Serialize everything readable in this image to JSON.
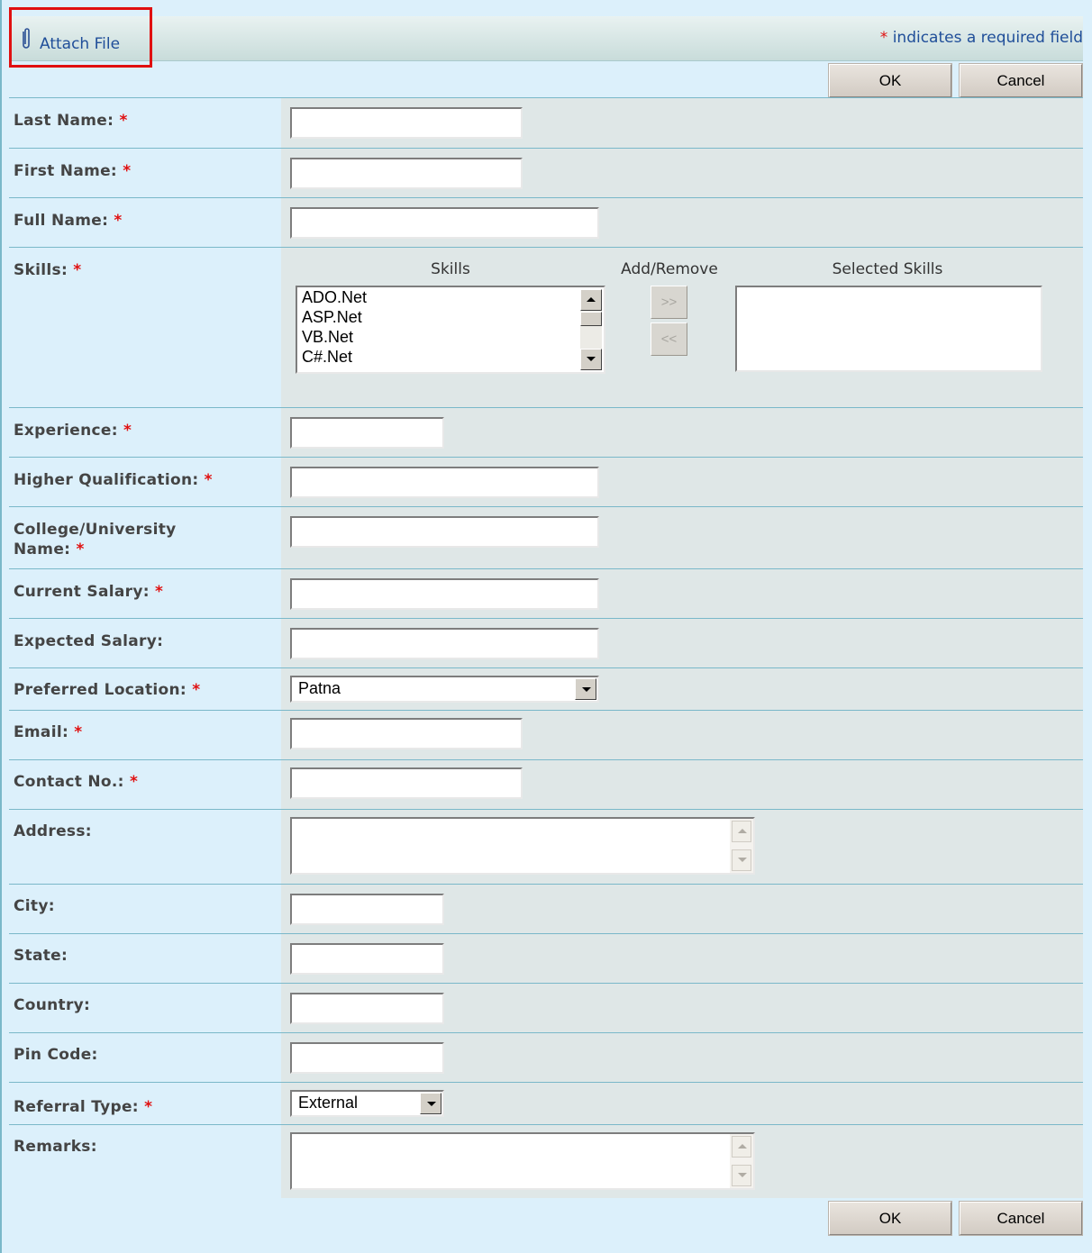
{
  "toolbar": {
    "attach_label": "Attach File",
    "required_note_star": "*",
    "required_note_text": " indicates a required field"
  },
  "buttons": {
    "ok": "OK",
    "cancel": "Cancel"
  },
  "colors": {
    "required": "#e01010",
    "link": "#1f4e99",
    "page_bg": "#dcf0fb",
    "field_bg": "#dfe7e7"
  },
  "fields": {
    "last_name": {
      "label": "Last Name:",
      "value": ""
    },
    "first_name": {
      "label": "First Name:",
      "value": ""
    },
    "full_name": {
      "label": "Full Name:",
      "value": ""
    },
    "skills": {
      "label": "Skills:",
      "skills_header": "Skills",
      "add_remove_header": "Add/Remove",
      "selected_header": "Selected Skills",
      "options": [
        "ADO.Net",
        "ASP.Net",
        "VB.Net",
        "C#.Net"
      ],
      "add_button": ">>",
      "remove_button": "<<",
      "selected": []
    },
    "experience": {
      "label": "Experience:",
      "value": ""
    },
    "higher_qualification": {
      "label": "Higher Qualification:",
      "value": ""
    },
    "college": {
      "label_line1": "College/University",
      "label_line2": "Name:",
      "value": ""
    },
    "current_salary": {
      "label": "Current Salary:",
      "value": ""
    },
    "expected_salary": {
      "label": "Expected Salary:",
      "value": ""
    },
    "preferred_location": {
      "label": "Preferred Location:",
      "value": "Patna"
    },
    "email": {
      "label": "Email:",
      "value": ""
    },
    "contact_no": {
      "label": "Contact No.:",
      "value": ""
    },
    "address": {
      "label": "Address:",
      "value": ""
    },
    "city": {
      "label": "City:",
      "value": ""
    },
    "state": {
      "label": "State:",
      "value": ""
    },
    "country": {
      "label": "Country:",
      "value": ""
    },
    "pin_code": {
      "label": "Pin Code:",
      "value": ""
    },
    "referral_type": {
      "label": "Referral Type:",
      "value": "External"
    },
    "remarks": {
      "label": "Remarks:",
      "value": ""
    }
  },
  "required_star": "*"
}
